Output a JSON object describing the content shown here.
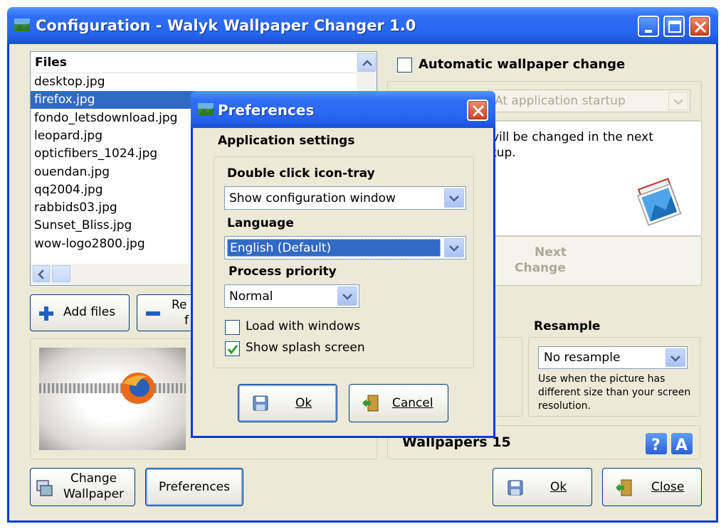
{
  "window": {
    "title": "Configuration - Walyk Wallpaper Changer 1.0",
    "files_header": "Files",
    "files": [
      "desktop.jpg",
      "firefox.jpg",
      "fondo_letsdownload.jpg",
      "leopard.jpg",
      "opticfibers_1024.jpg",
      "ouendan.jpg",
      "qq2004.jpg",
      "rabbids03.jpg",
      "Sunset_Bliss.jpg",
      "wow-logo2800.jpg"
    ],
    "selected_file_index": 1,
    "add_files_label": "Add files",
    "remove_files_line1": "Re",
    "remove_files_line2": "f",
    "auto_change_label": "Automatic wallpaper change",
    "auto_change_checked": false,
    "change_when_value": "At application startup",
    "change_info_line1": "vill be changed in the next",
    "change_info_line2": "tup.",
    "next_change_line1": "Next",
    "next_change_line2": "Change",
    "resample_header": "Resample",
    "resample_value": "No resample",
    "resample_help": "Use when the picture has different size than your screen resolution.",
    "wallpapers_count_label": "Wallpapers 15",
    "change_wallpaper_line1": "Change",
    "change_wallpaper_line2": "Wallpaper",
    "preferences_label": "Preferences",
    "ok_label": "Ok",
    "close_label": "Close"
  },
  "dialog": {
    "title": "Preferences",
    "section": "Application settings",
    "double_click_label": "Double click icon-tray",
    "double_click_value": "Show configuration window",
    "language_label": "Language",
    "language_value": "English (Default)",
    "priority_label": "Process priority",
    "priority_value": "Normal",
    "load_with_windows_label": "Load with windows",
    "load_with_windows_checked": false,
    "show_splash_label": "Show splash screen",
    "show_splash_checked": true,
    "ok_label": "Ok",
    "cancel_label": "Cancel"
  },
  "colors": {
    "title_bar": "#2766ef",
    "window_bg": "#ece9d8",
    "selection": "#316ac5",
    "border": "#0b3ad8"
  },
  "icons": [
    "app-icon",
    "minimize-icon",
    "maximize-icon",
    "close-icon",
    "plus-icon",
    "minus-icon",
    "photos-icon",
    "floppy-icon",
    "door-icon",
    "help-icon",
    "about-icon",
    "change-wallpaper-icon",
    "checkmark-icon",
    "chevron-down-icon"
  ]
}
